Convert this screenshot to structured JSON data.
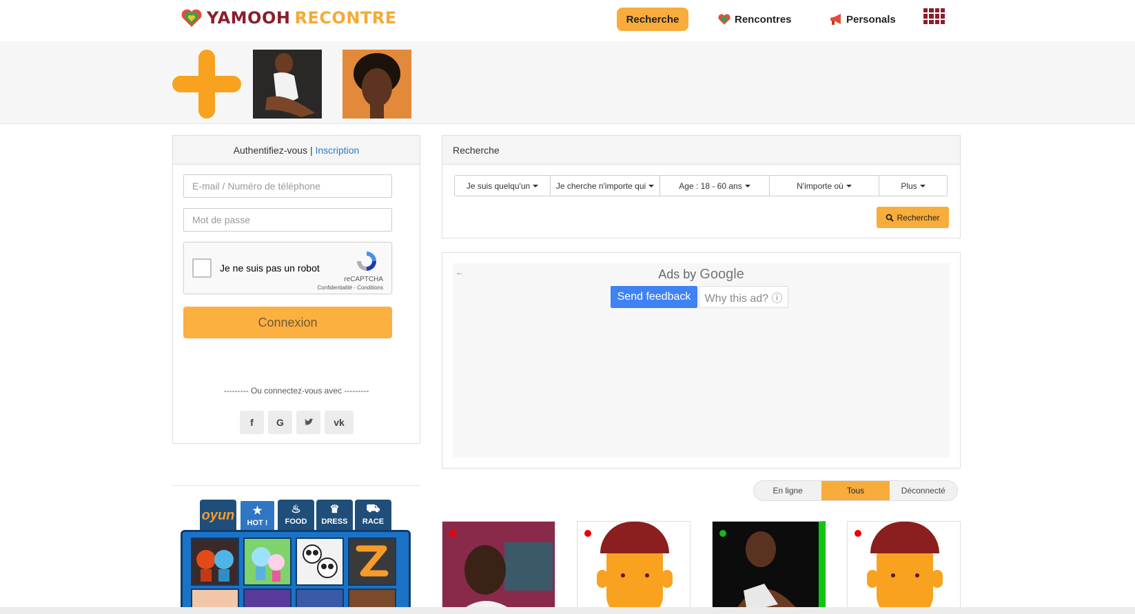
{
  "brand": {
    "name_part1": "YAMOOH",
    "name_part2": "RECONTRE"
  },
  "nav": {
    "recherche": "Recherche",
    "rencontres": "Rencontres",
    "personals": "Personals"
  },
  "login": {
    "title": "Authentifiez-vous",
    "separator": "|",
    "signup_link": "Inscription",
    "email_placeholder": "E-mail / Numéro de téléphone",
    "password_placeholder": "Mot de passe",
    "captcha_label": "Je ne suis pas un robot",
    "captcha_brand": "reCAPTCHA",
    "captcha_terms": "Confidentialité - Conditions",
    "submit": "Connexion",
    "or_connect": "--------- Ou connectez-vous avec ---------",
    "socials": [
      "f",
      "G",
      "t",
      "vk"
    ]
  },
  "search": {
    "title": "Recherche",
    "filters": [
      "Je suis quelqu'un",
      "Je cherche n'importe qui",
      "Age : 18 - 60 ans",
      "N'importe où",
      "Plus"
    ],
    "button": "Rechercher"
  },
  "ad": {
    "ads_by": "Ads by",
    "google": "Google",
    "send_feedback": "Send feedback",
    "why_this_ad": "Why this ad? ⓘ"
  },
  "status_toggle": {
    "options": [
      "En ligne",
      "Tous",
      "Déconnecté"
    ],
    "selected": "Tous"
  },
  "games": {
    "tabs": [
      "oyun",
      "HOT !",
      "FOOD",
      "DRESS",
      "RACE"
    ]
  },
  "colors": {
    "accent": "#f8ac3c",
    "brand_dark": "#8b1e2b",
    "link": "#2b7bc4"
  }
}
